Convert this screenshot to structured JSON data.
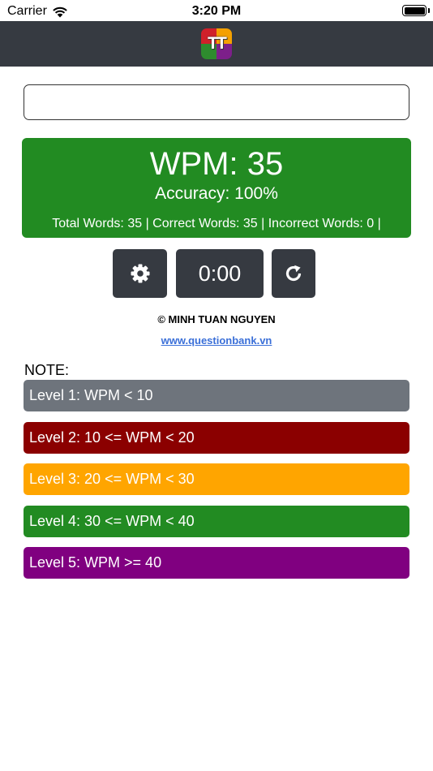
{
  "status_bar": {
    "carrier": "Carrier",
    "time": "3:20 PM"
  },
  "app": {
    "logo_text": "TT"
  },
  "input": {
    "value": "",
    "placeholder": ""
  },
  "stats": {
    "wpm": "WPM: 35",
    "accuracy": "Accuracy: 100%",
    "counts": "Total Words: 35 | Correct Words: 35 | Incorrect Words: 0 |",
    "color": "#228b22"
  },
  "controls": {
    "settings_icon": "gear-icon",
    "timer": "0:00",
    "reset_icon": "refresh-icon"
  },
  "footer": {
    "credit": "© MINH TUAN NGUYEN",
    "link": "www.questionbank.vn"
  },
  "note": {
    "title": "NOTE:",
    "levels": [
      {
        "label": "Level 1: WPM < 10",
        "color": "#6e747c"
      },
      {
        "label": "Level 2: 10 <= WPM < 20",
        "color": "#8b0000"
      },
      {
        "label": "Level 3: 20 <= WPM < 30",
        "color": "#ffa500"
      },
      {
        "label": "Level 4: 30 <= WPM < 40",
        "color": "#228b22"
      },
      {
        "label": "Level 5: WPM >= 40",
        "color": "#800080"
      }
    ]
  }
}
